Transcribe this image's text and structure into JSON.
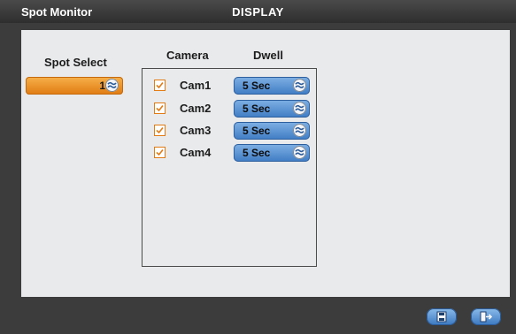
{
  "window": {
    "title_left": "Spot Monitor",
    "title_center": "DISPLAY"
  },
  "spot": {
    "label": "Spot Select",
    "value": "1",
    "icon": "spin-arrows-icon"
  },
  "table": {
    "headers": {
      "camera": "Camera",
      "dwell": "Dwell"
    },
    "rows": [
      {
        "camera": "Cam1",
        "checked": true,
        "dwell": "5 Sec"
      },
      {
        "camera": "Cam2",
        "checked": true,
        "dwell": "5 Sec"
      },
      {
        "camera": "Cam3",
        "checked": true,
        "dwell": "5 Sec"
      },
      {
        "camera": "Cam4",
        "checked": true,
        "dwell": "5 Sec"
      }
    ]
  },
  "footer": {
    "buttons": [
      {
        "name": "save-button",
        "icon": "save-icon"
      },
      {
        "name": "exit-button",
        "icon": "exit-icon"
      }
    ]
  },
  "colors": {
    "accent_orange": "#e07b12",
    "accent_blue": "#3f7cc4",
    "panel": "#e9eaec",
    "chrome": "#3c3c3c"
  }
}
